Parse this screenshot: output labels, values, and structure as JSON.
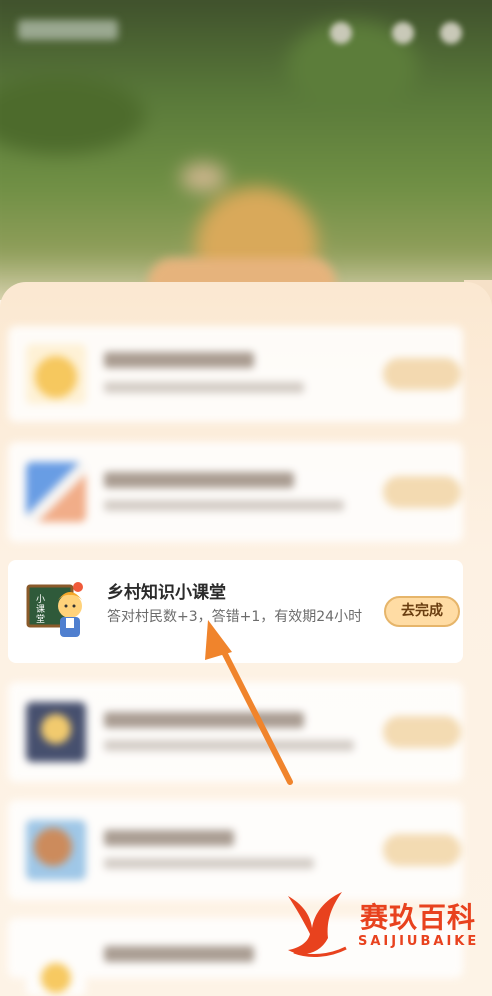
{
  "task": {
    "title": "乡村知识小课堂",
    "desc": "答对村民数+3，答错+1，有效期24小时",
    "button": "去完成"
  },
  "watermark": {
    "cn": "赛玖百科",
    "en": "SAIJIUBAIKE"
  },
  "colors": {
    "accent_arrow": "#f0842c",
    "button_fill": "#ffdca4",
    "watermark": "#e8421e"
  }
}
